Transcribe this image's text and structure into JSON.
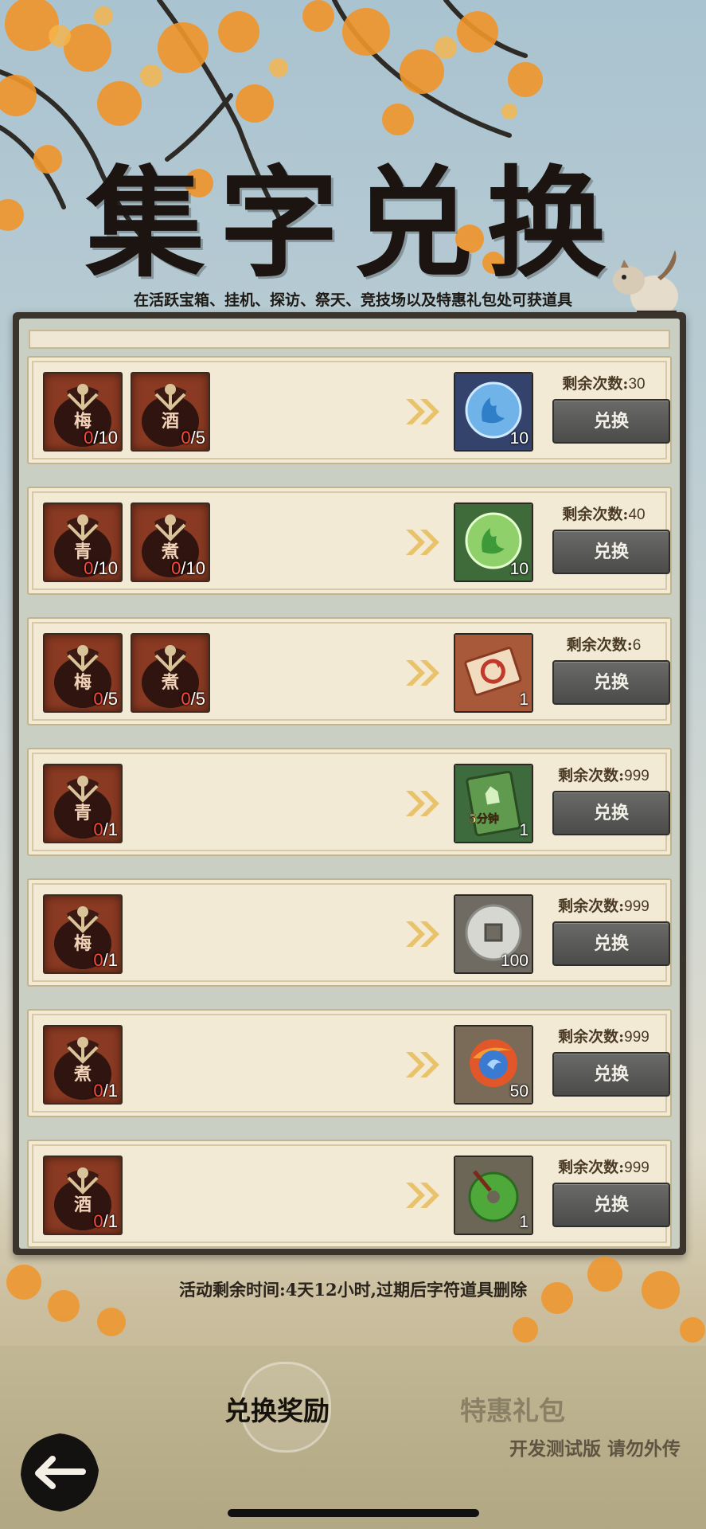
{
  "header": {
    "title": "集字兑换",
    "subtitle": "在活跃宝箱、挂机、探访、祭天、竞技场以及特惠礼包处可获道具"
  },
  "exchange": {
    "remain_label": "剩余次数:",
    "button_label": "兑换",
    "rows": [
      {
        "inputs": [
          {
            "char": "梅",
            "have": "0",
            "need": "/10"
          },
          {
            "char": "酒",
            "have": "0",
            "need": "/5"
          }
        ],
        "reward": {
          "icon": "blue-flame-orb-icon",
          "qty": "10"
        },
        "remain": "30"
      },
      {
        "inputs": [
          {
            "char": "青",
            "have": "0",
            "need": "/10"
          },
          {
            "char": "煮",
            "have": "0",
            "need": "/10"
          }
        ],
        "reward": {
          "icon": "green-flame-orb-icon",
          "qty": "10"
        },
        "remain": "40"
      },
      {
        "inputs": [
          {
            "char": "梅",
            "have": "0",
            "need": "/5"
          },
          {
            "char": "煮",
            "have": "0",
            "need": "/5"
          }
        ],
        "reward": {
          "icon": "refresh-ticket-icon",
          "qty": "1"
        },
        "remain": "6"
      },
      {
        "inputs": [
          {
            "char": "青",
            "have": "0",
            "need": "/1"
          }
        ],
        "reward": {
          "icon": "five-minute-card-icon",
          "label": "5分钟",
          "qty": "1"
        },
        "remain": "999"
      },
      {
        "inputs": [
          {
            "char": "梅",
            "have": "0",
            "need": "/1"
          }
        ],
        "reward": {
          "icon": "copper-coin-icon",
          "qty": "100"
        },
        "remain": "999"
      },
      {
        "inputs": [
          {
            "char": "煮",
            "have": "0",
            "need": "/1"
          }
        ],
        "reward": {
          "icon": "fire-water-orb-icon",
          "qty": "50"
        },
        "remain": "999"
      },
      {
        "inputs": [
          {
            "char": "酒",
            "have": "0",
            "need": "/1"
          }
        ],
        "reward": {
          "icon": "jade-disc-icon",
          "qty": "1"
        },
        "remain": "999"
      }
    ]
  },
  "footer": {
    "timer": "活动剩余时间:4天12小时,过期后字符道具删除"
  },
  "tabs": {
    "exchange": "兑换奖励",
    "gift": "特惠礼包"
  },
  "dev_note": "开发测试版 请勿外传",
  "colors": {
    "jar_bg": "#8a3a22",
    "count_red": "#ff4a3a",
    "button": "#555553",
    "row_bg": "#f3ead6"
  }
}
